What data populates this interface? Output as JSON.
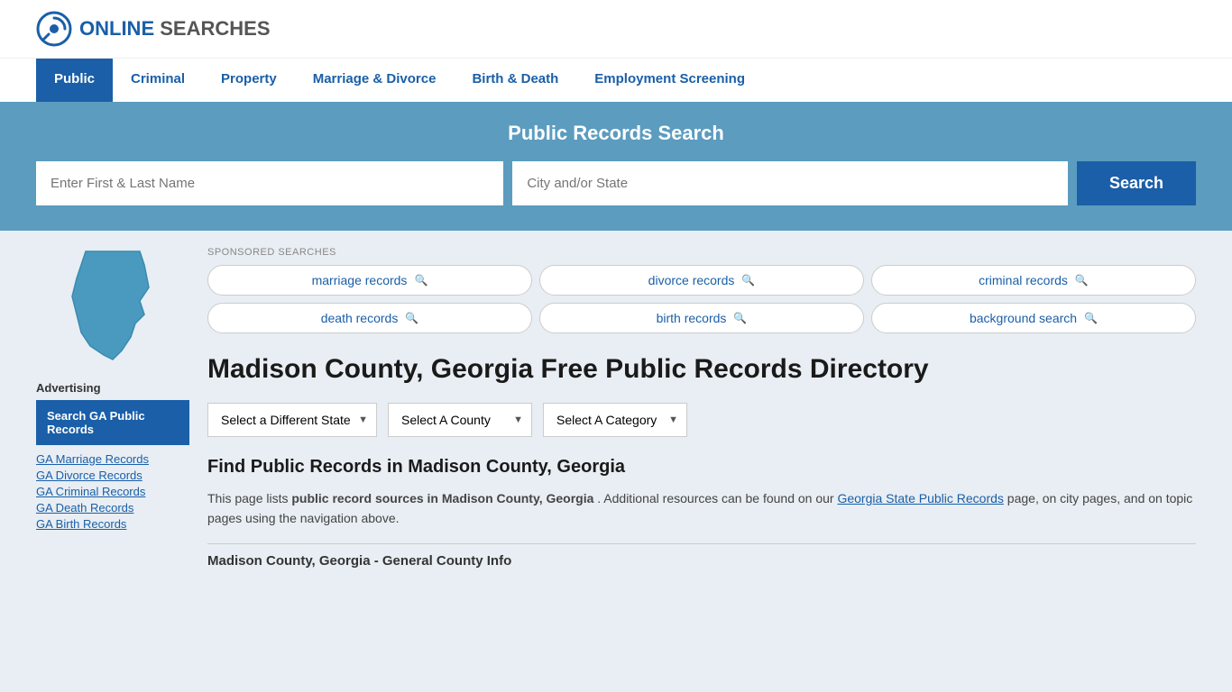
{
  "header": {
    "logo_online": "ONLINE",
    "logo_searches": "SEARCHES"
  },
  "nav": {
    "items": [
      {
        "label": "Public",
        "active": true
      },
      {
        "label": "Criminal",
        "active": false
      },
      {
        "label": "Property",
        "active": false
      },
      {
        "label": "Marriage & Divorce",
        "active": false
      },
      {
        "label": "Birth & Death",
        "active": false
      },
      {
        "label": "Employment Screening",
        "active": false
      }
    ]
  },
  "search_band": {
    "title": "Public Records Search",
    "name_placeholder": "Enter First & Last Name",
    "city_placeholder": "City and/or State",
    "search_button": "Search"
  },
  "sponsored": {
    "label": "SPONSORED SEARCHES",
    "items": [
      "marriage records",
      "divorce records",
      "criminal records",
      "death records",
      "birth records",
      "background search"
    ]
  },
  "sidebar": {
    "advertising_label": "Advertising",
    "banner_text": "Search GA Public Records",
    "links": [
      "GA Marriage Records",
      "GA Divorce Records",
      "GA Criminal Records",
      "GA Death Records",
      "GA Birth Records"
    ]
  },
  "page": {
    "title": "Madison County, Georgia Free Public Records Directory",
    "dropdowns": {
      "state": "Select a Different State",
      "county": "Select A County",
      "category": "Select A Category"
    },
    "find_title": "Find Public Records in Madison County, Georgia",
    "find_text_1": "This page lists ",
    "find_text_bold": "public record sources in Madison County, Georgia",
    "find_text_2": ". Additional resources can be found on our ",
    "find_link": "Georgia State Public Records",
    "find_text_3": " page, on city pages, and on topic pages using the navigation above.",
    "county_info_header": "Madison County, Georgia - General County Info"
  }
}
